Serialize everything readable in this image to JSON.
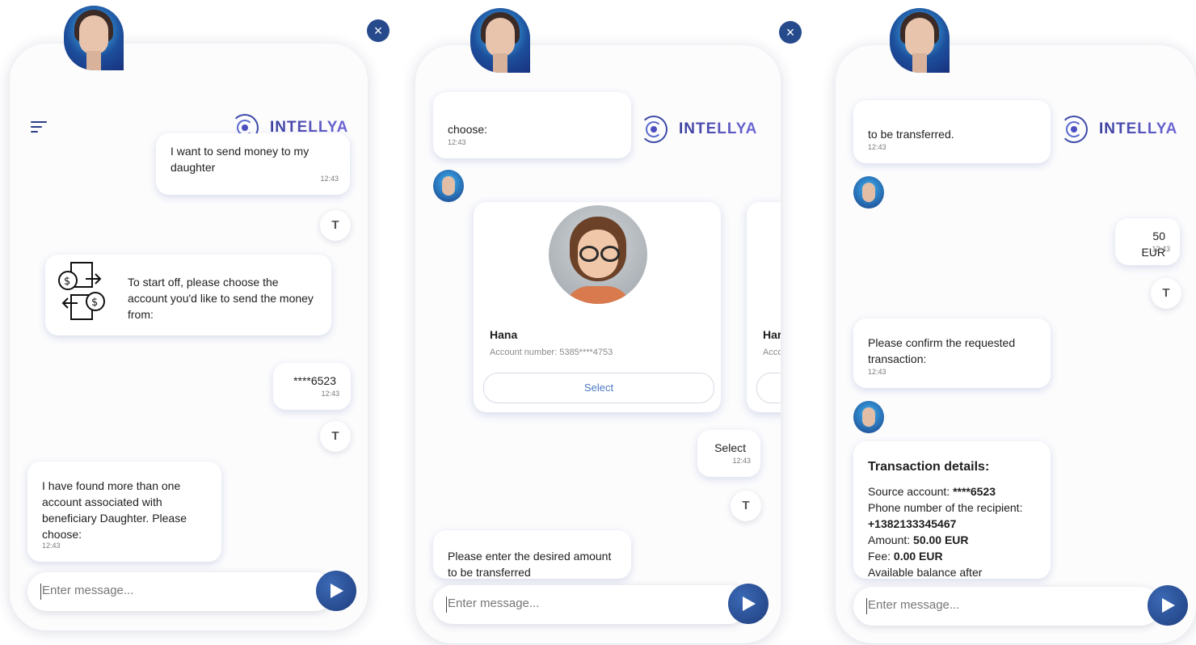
{
  "brand": {
    "name": "INTELLYA"
  },
  "common": {
    "input_placeholder": "Enter message...",
    "close_symbol": "×",
    "bot_reply_icon": "T"
  },
  "panel1": {
    "msg_user_1": {
      "text": "I want to send money to my daughter",
      "time": "12:43"
    },
    "msg_bot_1": {
      "text": "To start off, please choose the account you'd like to send the money from:"
    },
    "msg_user_2": {
      "text": "****6523",
      "time": "12:43"
    },
    "msg_bot_2": {
      "text": "I have found more than one account associated with beneficiary Daughter. Please choose:",
      "time": "12:43"
    }
  },
  "panel2": {
    "msg_bot_top": {
      "text": "choose:",
      "time": "12:43"
    },
    "account_card": {
      "name": "Hana",
      "account": "Account number: 5385****4753",
      "button": "Select"
    },
    "account_card_partial": {
      "name": "Har",
      "account": "Acco"
    },
    "msg_user_select": {
      "text": "Select",
      "time": "12:43"
    },
    "msg_bot_amount": {
      "text": "Please enter the desired amount to be transferred"
    }
  },
  "panel3": {
    "msg_bot_top": {
      "text": "to be transferred.",
      "time": "12:43"
    },
    "msg_user_amount": {
      "text": "50 EUR",
      "time": "12:43"
    },
    "msg_bot_confirm": {
      "text": "Please confirm the requested transaction:",
      "time": "12:43"
    },
    "details": {
      "title": "Transaction details:",
      "source_label": "Source account:",
      "source_value": "****6523",
      "phone_label": "Phone number of the recipient:",
      "phone_value": "+1382133345467",
      "amount_label": "Amount:",
      "amount_value": "50.00 EUR",
      "fee_label": "Fee:",
      "fee_value": "0.00 EUR",
      "balance_label": "Available balance after"
    }
  }
}
